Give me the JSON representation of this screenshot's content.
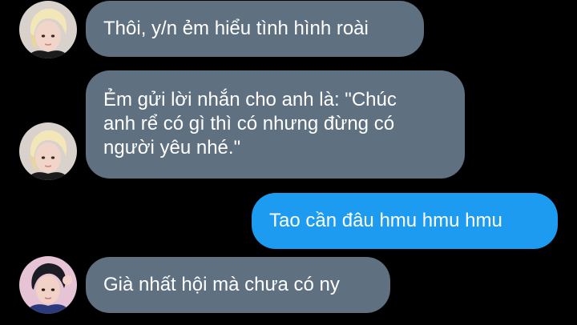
{
  "messages": [
    {
      "sender": "incoming",
      "avatar": "blond-hair-avatar",
      "text": "Thôi, y/n ẻm hiểu tình hình roài"
    },
    {
      "sender": "incoming",
      "avatar": "blond-hair-avatar",
      "lines": [
        "Ẻm gửi lời nhắn cho anh là: \"Chúc",
        "anh rể có gì thì có nhưng đừng có",
        "người yêu nhé.\""
      ]
    },
    {
      "sender": "outgoing",
      "text": "Tao cần đâu hmu hmu hmu"
    },
    {
      "sender": "incoming",
      "avatar": "dark-hair-avatar",
      "text": "Già nhất hội mà chưa có ny"
    }
  ],
  "colors": {
    "background": "#000000",
    "incoming_bubble": "#5f7081",
    "outgoing_bubble": "#1d9bf0",
    "text": "#ffffff"
  }
}
